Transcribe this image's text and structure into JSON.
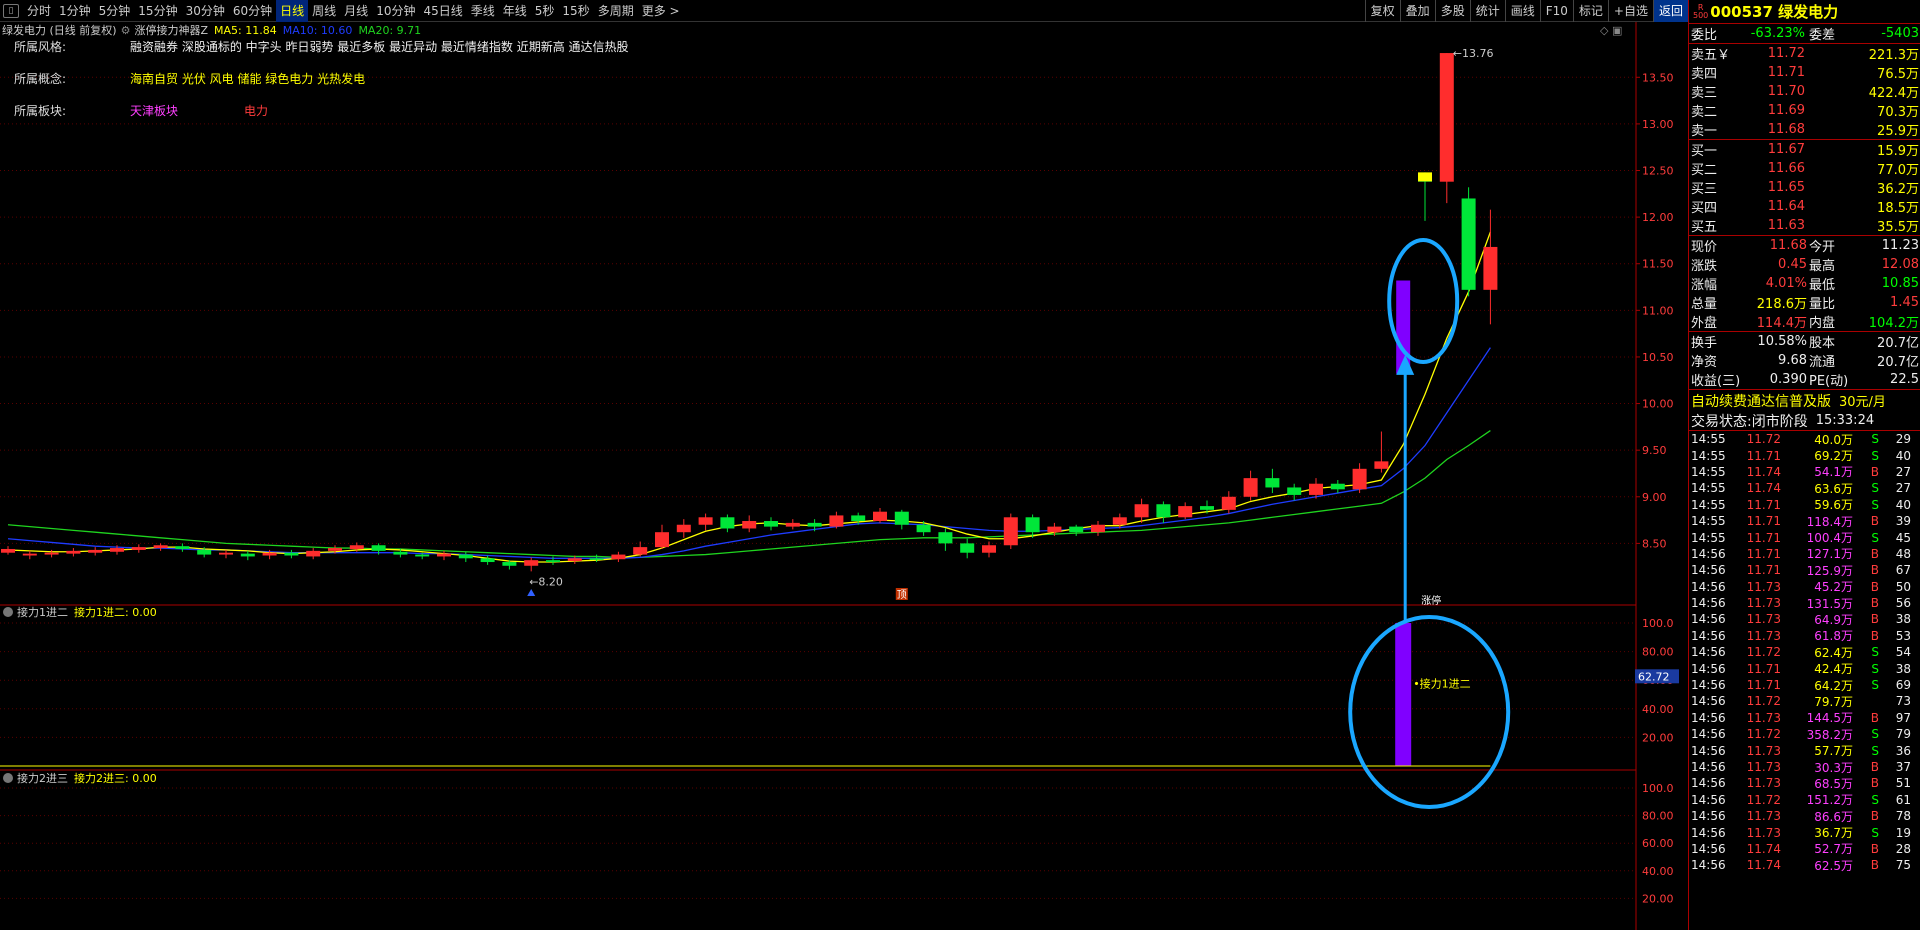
{
  "toolbar": {
    "periods": [
      "分时",
      "1分钟",
      "5分钟",
      "15分钟",
      "30分钟",
      "60分钟",
      "日线",
      "周线",
      "月线",
      "10分钟",
      "45日线",
      "季线",
      "年线",
      "5秒",
      "15秒",
      "多周期",
      "更多 >"
    ],
    "active_period": "日线",
    "tools": [
      "复权",
      "叠加",
      "多股",
      "统计",
      "画线",
      "F10",
      "标记",
      "+自选",
      "返回"
    ],
    "active_tool": "返回"
  },
  "legend": {
    "stock": "绿发电力 (日线 前复权)",
    "indicator": "涨停接力神器Z",
    "ma5": "MA5: 11.84",
    "ma10": "MA10: 10.60",
    "ma20": "MA20: 9.71"
  },
  "info": {
    "style_label": "所属风格:",
    "style_value": "融资融券 深股通标的 中字头 昨日弱势 最近多板 最近异动 最近情绪指数 近期新高 通达信热股",
    "concept_label": "所属概念:",
    "concept_value": "海南自贸 光伏 风电 储能 绿色电力 光热发电",
    "sector_label": "所属板块:",
    "sector_value1": "天津板块",
    "sector_value2": "电力"
  },
  "annotations": {
    "high_label": "13.76",
    "low_label": "8.20",
    "trade_marker": "顶",
    "sub1_label": "接力1进二",
    "sub1_value_tag": "62.72",
    "marker_top": "涨停"
  },
  "sub1": {
    "name": "接力1进二",
    "value_text": "接力1进二: 0.00"
  },
  "sub2": {
    "name": "接力2进三",
    "value_text": "接力2进三: 0.00"
  },
  "colors": {
    "up": "#ff2d2d",
    "down": "#00e639",
    "ma5": "#ffff00",
    "ma10": "#1e3cff",
    "ma20": "#1fd41f",
    "highlight": "#8000ff",
    "circle": "#1aa7ff"
  },
  "chart_data": {
    "type": "candlestick",
    "ylim": [
      8.0,
      13.9
    ],
    "yticks": [
      "13.50",
      "13.00",
      "12.50",
      "12.00",
      "11.50",
      "11.00",
      "10.50",
      "10.00",
      "9.50",
      "9.00",
      "8.50"
    ],
    "sub_yticks": [
      "100.0",
      "80.00",
      "60.00",
      "40.00",
      "20.00"
    ],
    "candles": [
      [
        8.4,
        8.44,
        8.38,
        8.47
      ],
      [
        8.37,
        8.39,
        8.33,
        8.42
      ],
      [
        8.38,
        8.4,
        8.35,
        8.43
      ],
      [
        8.39,
        8.42,
        8.36,
        8.45
      ],
      [
        8.4,
        8.43,
        8.37,
        8.46
      ],
      [
        8.41,
        8.45,
        8.38,
        8.48
      ],
      [
        8.43,
        8.46,
        8.4,
        8.49
      ],
      [
        8.45,
        8.48,
        8.42,
        8.5
      ],
      [
        8.47,
        8.44,
        8.41,
        8.5
      ],
      [
        8.43,
        8.38,
        8.35,
        8.46
      ],
      [
        8.38,
        8.4,
        8.34,
        8.43
      ],
      [
        8.39,
        8.36,
        8.32,
        8.42
      ],
      [
        8.37,
        8.4,
        8.33,
        8.43
      ],
      [
        8.4,
        8.37,
        8.34,
        8.43
      ],
      [
        8.36,
        8.42,
        8.33,
        8.45
      ],
      [
        8.42,
        8.45,
        8.39,
        8.48
      ],
      [
        8.44,
        8.48,
        8.41,
        8.51
      ],
      [
        8.48,
        8.42,
        8.38,
        8.5
      ],
      [
        8.41,
        8.38,
        8.35,
        8.44
      ],
      [
        8.38,
        8.36,
        8.33,
        8.4
      ],
      [
        8.36,
        8.39,
        8.32,
        8.42
      ],
      [
        8.38,
        8.34,
        8.3,
        8.41
      ],
      [
        8.34,
        8.3,
        8.27,
        8.37
      ],
      [
        8.3,
        8.26,
        8.22,
        8.32
      ],
      [
        8.26,
        8.32,
        8.2,
        8.35
      ],
      [
        8.32,
        8.3,
        8.27,
        8.36
      ],
      [
        8.31,
        8.34,
        8.28,
        8.37
      ],
      [
        8.34,
        8.33,
        8.3,
        8.38
      ],
      [
        8.33,
        8.38,
        8.3,
        8.41
      ],
      [
        8.38,
        8.46,
        8.36,
        8.52
      ],
      [
        8.46,
        8.62,
        8.44,
        8.7
      ],
      [
        8.62,
        8.7,
        8.56,
        8.76
      ],
      [
        8.7,
        8.78,
        8.64,
        8.82
      ],
      [
        8.78,
        8.66,
        8.62,
        8.81
      ],
      [
        8.66,
        8.74,
        8.62,
        8.8
      ],
      [
        8.74,
        8.68,
        8.64,
        8.78
      ],
      [
        8.68,
        8.72,
        8.65,
        8.76
      ],
      [
        8.72,
        8.68,
        8.63,
        8.76
      ],
      [
        8.68,
        8.8,
        8.66,
        8.84
      ],
      [
        8.8,
        8.74,
        8.7,
        8.83
      ],
      [
        8.74,
        8.84,
        8.72,
        8.88
      ],
      [
        8.84,
        8.7,
        8.65,
        8.86
      ],
      [
        8.7,
        8.62,
        8.58,
        8.74
      ],
      [
        8.62,
        8.5,
        8.42,
        8.66
      ],
      [
        8.5,
        8.4,
        8.34,
        8.55
      ],
      [
        8.4,
        8.48,
        8.35,
        8.52
      ],
      [
        8.48,
        8.78,
        8.44,
        8.82
      ],
      [
        8.78,
        8.62,
        8.56,
        8.81
      ],
      [
        8.62,
        8.68,
        8.58,
        8.72
      ],
      [
        8.68,
        8.62,
        8.58,
        8.7
      ],
      [
        8.62,
        8.7,
        8.58,
        8.74
      ],
      [
        8.7,
        8.78,
        8.66,
        8.82
      ],
      [
        8.78,
        8.92,
        8.72,
        8.98
      ],
      [
        8.92,
        8.78,
        8.72,
        8.95
      ],
      [
        8.78,
        8.9,
        8.76,
        8.94
      ],
      [
        8.9,
        8.86,
        8.82,
        8.96
      ],
      [
        8.86,
        9.0,
        8.82,
        9.06
      ],
      [
        9.0,
        9.2,
        8.96,
        9.28
      ],
      [
        9.2,
        9.1,
        9.04,
        9.3
      ],
      [
        9.1,
        9.02,
        8.96,
        9.14
      ],
      [
        9.02,
        9.14,
        8.98,
        9.2
      ],
      [
        9.14,
        9.08,
        9.04,
        9.18
      ],
      [
        9.08,
        9.3,
        9.04,
        9.36
      ],
      [
        9.3,
        9.38,
        9.26,
        9.7
      ],
      [
        10.32,
        11.32,
        10.32,
        11.32
      ],
      [
        12.45,
        12.38,
        11.96,
        12.48
      ],
      [
        12.38,
        13.76,
        12.15,
        13.76
      ],
      [
        12.2,
        11.22,
        11.15,
        12.32
      ],
      [
        11.22,
        11.68,
        10.85,
        12.08
      ]
    ],
    "ma5": [
      8.43,
      8.42,
      8.41,
      8.41,
      8.42,
      8.43,
      8.44,
      8.46,
      8.46,
      8.44,
      8.43,
      8.42,
      8.4,
      8.39,
      8.4,
      8.41,
      8.43,
      8.44,
      8.43,
      8.41,
      8.39,
      8.37,
      8.34,
      8.31,
      8.3,
      8.3,
      8.31,
      8.32,
      8.34,
      8.38,
      8.45,
      8.54,
      8.63,
      8.68,
      8.71,
      8.72,
      8.7,
      8.69,
      8.71,
      8.73,
      8.75,
      8.74,
      8.72,
      8.67,
      8.6,
      8.55,
      8.55,
      8.58,
      8.62,
      8.66,
      8.69,
      8.69,
      8.74,
      8.78,
      8.81,
      8.84,
      8.87,
      8.95,
      9.0,
      9.04,
      9.09,
      9.11,
      9.13,
      9.18,
      9.56,
      10.1,
      10.7,
      11.2,
      11.84
    ],
    "ma10": [
      8.55,
      8.53,
      8.51,
      8.49,
      8.47,
      8.46,
      8.45,
      8.45,
      8.44,
      8.43,
      8.43,
      8.42,
      8.41,
      8.4,
      8.4,
      8.4,
      8.4,
      8.4,
      8.4,
      8.39,
      8.39,
      8.38,
      8.37,
      8.36,
      8.35,
      8.34,
      8.34,
      8.34,
      8.34,
      8.35,
      8.38,
      8.42,
      8.47,
      8.51,
      8.55,
      8.59,
      8.62,
      8.65,
      8.68,
      8.71,
      8.72,
      8.71,
      8.7,
      8.68,
      8.66,
      8.64,
      8.63,
      8.63,
      8.64,
      8.65,
      8.66,
      8.67,
      8.69,
      8.72,
      8.75,
      8.78,
      8.82,
      8.87,
      8.92,
      8.96,
      9.0,
      9.04,
      9.08,
      9.12,
      9.3,
      9.55,
      9.9,
      10.25,
      10.6
    ],
    "ma20": [
      8.7,
      8.68,
      8.66,
      8.64,
      8.62,
      8.6,
      8.58,
      8.56,
      8.54,
      8.52,
      8.5,
      8.49,
      8.48,
      8.47,
      8.46,
      8.45,
      8.45,
      8.44,
      8.44,
      8.43,
      8.42,
      8.41,
      8.4,
      8.39,
      8.38,
      8.37,
      8.36,
      8.36,
      8.35,
      8.35,
      8.36,
      8.37,
      8.38,
      8.4,
      8.42,
      8.44,
      8.46,
      8.48,
      8.5,
      8.52,
      8.54,
      8.55,
      8.56,
      8.56,
      8.56,
      8.57,
      8.58,
      8.59,
      8.6,
      8.61,
      8.62,
      8.63,
      8.64,
      8.66,
      8.68,
      8.7,
      8.72,
      8.75,
      8.78,
      8.81,
      8.84,
      8.87,
      8.9,
      8.93,
      9.05,
      9.2,
      9.4,
      9.55,
      9.71
    ],
    "sub1_values": [
      0,
      0,
      0,
      0,
      0,
      0,
      0,
      0,
      0,
      0,
      0,
      0,
      0,
      0,
      0,
      0,
      0,
      0,
      0,
      0,
      0,
      0,
      0,
      0,
      0,
      0,
      0,
      0,
      0,
      0,
      0,
      0,
      0,
      0,
      0,
      0,
      0,
      0,
      0,
      0,
      0,
      0,
      0,
      0,
      0,
      0,
      0,
      0,
      0,
      0,
      0,
      0,
      0,
      0,
      0,
      0,
      0,
      0,
      0,
      0,
      0,
      0,
      0,
      0,
      100,
      0,
      0,
      0,
      0
    ]
  },
  "quote": {
    "code_name": "000537 绿发电力",
    "rows": [
      {
        "label": "委比",
        "value": "-63.23%",
        "label2": "委差",
        "value2": "-5403",
        "c1": "c-green",
        "c2": "c-green"
      }
    ],
    "sells": [
      {
        "label": "卖五￥",
        "price": "11.72",
        "vol": "221.3万"
      },
      {
        "label": "卖四",
        "price": "11.71",
        "vol": "76.5万"
      },
      {
        "label": "卖三",
        "price": "11.70",
        "vol": "422.4万"
      },
      {
        "label": "卖二",
        "price": "11.69",
        "vol": "70.3万"
      },
      {
        "label": "卖一",
        "price": "11.68",
        "vol": "25.9万"
      }
    ],
    "buys": [
      {
        "label": "买一",
        "price": "11.67",
        "vol": "15.9万"
      },
      {
        "label": "买二",
        "price": "11.66",
        "vol": "77.0万"
      },
      {
        "label": "买三",
        "price": "11.65",
        "vol": "36.2万"
      },
      {
        "label": "买四",
        "price": "11.64",
        "vol": "18.5万"
      },
      {
        "label": "买五",
        "price": "11.63",
        "vol": "35.5万"
      }
    ],
    "stats": [
      {
        "l1": "现价",
        "v1": "11.68",
        "c1": "c-red",
        "l2": "今开",
        "v2": "11.23",
        "c2": "c-white"
      },
      {
        "l1": "涨跌",
        "v1": "0.45",
        "c1": "c-red",
        "l2": "最高",
        "v2": "12.08",
        "c2": "c-red"
      },
      {
        "l1": "涨幅",
        "v1": "4.01%",
        "c1": "c-red",
        "l2": "最低",
        "v2": "10.85",
        "c2": "c-green"
      },
      {
        "l1": "总量",
        "v1": "218.6万",
        "c1": "c-yellow",
        "l2": "量比",
        "v2": "1.45",
        "c2": "c-red"
      },
      {
        "l1": "外盘",
        "v1": "114.4万",
        "c1": "c-red",
        "l2": "内盘",
        "v2": "104.2万",
        "c2": "c-green"
      }
    ],
    "stats2": [
      {
        "l1": "换手",
        "v1": "10.58%",
        "c1": "c-white",
        "l2": "股本",
        "v2": "20.7亿",
        "c2": "c-white"
      },
      {
        "l1": "净资",
        "v1": "9.68",
        "c1": "c-white",
        "l2": "流通",
        "v2": "20.7亿",
        "c2": "c-white"
      },
      {
        "l1": "收益(三)",
        "v1": "0.390",
        "c1": "c-white",
        "l2": "PE(动)",
        "v2": "22.5",
        "c2": "c-white"
      }
    ],
    "banner": "自动续费通达信普及版",
    "banner_price": "30元/月",
    "status_label": "交易状态:",
    "status_value": "闭市阶段",
    "status_time": "15:33:24",
    "ticks": [
      [
        "14:55",
        "11.72",
        "40.0万",
        "S",
        "29"
      ],
      [
        "14:55",
        "11.71",
        "69.2万",
        "S",
        "40"
      ],
      [
        "14:55",
        "11.74",
        "54.1万",
        "B",
        "27"
      ],
      [
        "14:55",
        "11.74",
        "63.6万",
        "S",
        "27"
      ],
      [
        "14:55",
        "11.71",
        "59.6万",
        "S",
        "40"
      ],
      [
        "14:55",
        "11.71",
        "118.4万",
        "B",
        "39"
      ],
      [
        "14:55",
        "11.71",
        "100.4万",
        "S",
        "45"
      ],
      [
        "14:56",
        "11.71",
        "127.1万",
        "B",
        "48"
      ],
      [
        "14:56",
        "11.71",
        "125.9万",
        "B",
        "67"
      ],
      [
        "14:56",
        "11.73",
        "45.2万",
        "B",
        "50"
      ],
      [
        "14:56",
        "11.73",
        "131.5万",
        "B",
        "56"
      ],
      [
        "14:56",
        "11.73",
        "64.9万",
        "B",
        "38"
      ],
      [
        "14:56",
        "11.73",
        "61.8万",
        "B",
        "53"
      ],
      [
        "14:56",
        "11.72",
        "62.4万",
        "S",
        "54"
      ],
      [
        "14:56",
        "11.71",
        "42.4万",
        "S",
        "38"
      ],
      [
        "14:56",
        "11.71",
        "64.2万",
        "S",
        "69"
      ],
      [
        "14:56",
        "11.72",
        "79.7万",
        "",
        "73"
      ],
      [
        "14:56",
        "11.73",
        "144.5万",
        "B",
        "97"
      ],
      [
        "14:56",
        "11.72",
        "358.2万",
        "S",
        "79"
      ],
      [
        "14:56",
        "11.73",
        "57.7万",
        "S",
        "36"
      ],
      [
        "14:56",
        "11.73",
        "30.3万",
        "B",
        "37"
      ],
      [
        "14:56",
        "11.73",
        "68.5万",
        "B",
        "51"
      ],
      [
        "14:56",
        "11.72",
        "151.2万",
        "S",
        "61"
      ],
      [
        "14:56",
        "11.73",
        "86.6万",
        "B",
        "78"
      ],
      [
        "14:56",
        "11.73",
        "36.7万",
        "S",
        "19"
      ],
      [
        "14:56",
        "11.74",
        "52.7万",
        "B",
        "28"
      ],
      [
        "14:56",
        "11.74",
        "62.5万",
        "B",
        "75"
      ]
    ]
  }
}
